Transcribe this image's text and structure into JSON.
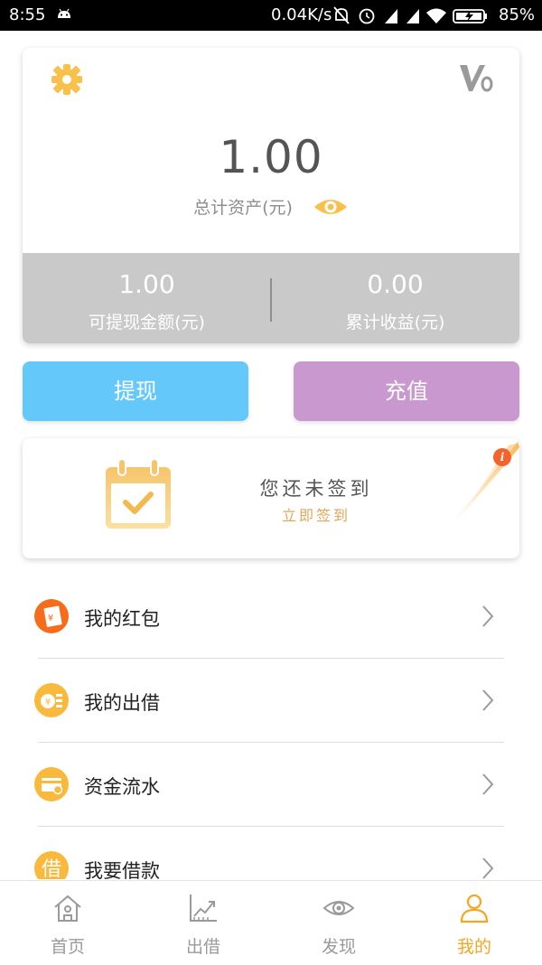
{
  "status_bar": {
    "time": "8:55",
    "network_speed": "0.04K/s",
    "battery_percent": "85%"
  },
  "asset_card": {
    "total_value": "1.00",
    "total_label": "总计资产(元)",
    "withdrawable_value": "1.00",
    "withdrawable_label": "可提现金额(元)",
    "earnings_value": "0.00",
    "earnings_label": "累计收益(元)",
    "vip_level": "V0"
  },
  "actions": {
    "withdraw_label": "提现",
    "recharge_label": "充值"
  },
  "checkin": {
    "title": "您还未签到",
    "link": "立即签到",
    "badge": "i"
  },
  "menu": {
    "items": [
      {
        "label": "我的红包",
        "icon": "red-envelope-icon"
      },
      {
        "label": "我的出借",
        "icon": "coin-icon"
      },
      {
        "label": "资金流水",
        "icon": "wallet-card-icon"
      },
      {
        "label": "我要借款",
        "icon": "borrow-icon"
      }
    ]
  },
  "tabs": [
    {
      "label": "首页",
      "icon": "home-icon"
    },
    {
      "label": "出借",
      "icon": "chart-icon"
    },
    {
      "label": "发现",
      "icon": "eye-icon"
    },
    {
      "label": "我的",
      "icon": "user-icon"
    }
  ],
  "colors": {
    "accent_orange": "#f6a623",
    "withdraw_blue": "#64c8fa",
    "recharge_purple": "#c898ce",
    "card_gray": "#c9c9c9"
  }
}
